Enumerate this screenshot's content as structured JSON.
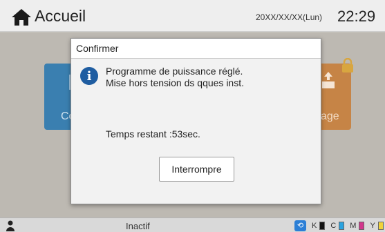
{
  "topbar": {
    "title": "Accueil",
    "date": "20XX/XX/XX(Lun)",
    "time": "22:29"
  },
  "background_tiles": {
    "left_label": "Co",
    "right_label": "age"
  },
  "dialog": {
    "title": "Confirmer",
    "message_line1": "Programme de puissance réglé.",
    "message_line2": "Mise hors tension ds qques inst.",
    "remaining": "Temps restant :53sec.",
    "button_label": "Interrompre"
  },
  "statusbar": {
    "status": "Inactif",
    "toner_labels": [
      "K",
      "C",
      "M",
      "Y"
    ],
    "toner_colors": [
      "#111111",
      "#2aa3e0",
      "#d2378d",
      "#f0d23a"
    ]
  },
  "icons": {
    "home": "home-icon",
    "info": "info-icon",
    "user": "user-icon",
    "lock": "lock-icon",
    "eco": "eco-icon"
  }
}
